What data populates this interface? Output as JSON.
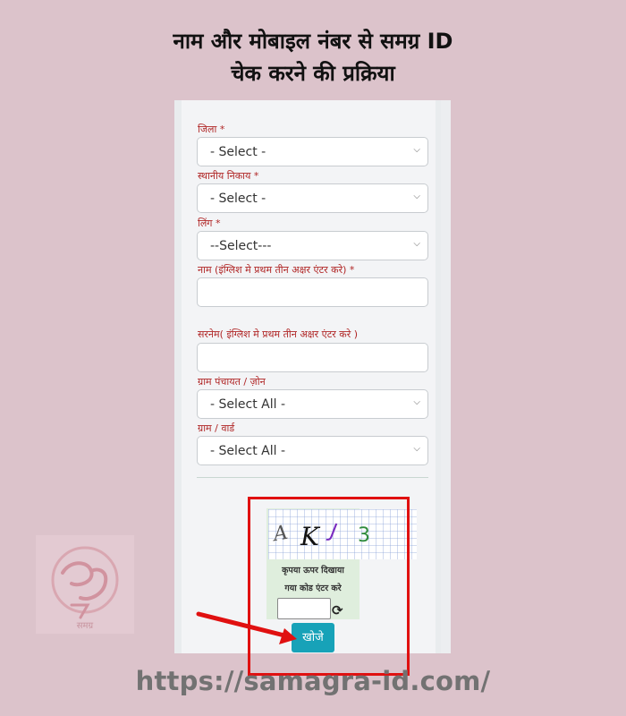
{
  "heading": {
    "line1": "नाम और मोबाइल नंबर से समग्र ID",
    "line2": "चेक करने की प्रक्रिया"
  },
  "form": {
    "district_label": "जिला *",
    "district_value": "- Select -",
    "local_body_label": "स्थानीय निकाय *",
    "local_body_value": "- Select -",
    "gender_label": "लिंग *",
    "gender_value": "--Select---",
    "name_label": "नाम (इंग्लिश मे प्रथम तीन अक्षर एंटर करे) *",
    "name_value": "",
    "surname_label": "सरनेम( इंग्लिश मे प्रथम तीन अक्षर एंटर करे )",
    "surname_value": "",
    "gram_panchayat_label": "ग्राम पंचायत / ज़ोन",
    "gram_panchayat_value": "- Select All -",
    "village_label": "ग्राम / वार्ड",
    "village_value": "- Select All -"
  },
  "captcha": {
    "chars": [
      "A",
      "K",
      "J",
      "3"
    ],
    "message_line1": "कृपया ऊपर दिखाया",
    "message_line2": "गया कोड एंटर करे",
    "input_value": "",
    "refresh_icon": "refresh-icon"
  },
  "search_button": "खोजे",
  "footer_url": "https://samagra-id.com/",
  "logo_text": "समग्र",
  "colors": {
    "background": "#dcc3cb",
    "label_red": "#b02626",
    "button": "#17a2b8",
    "highlight": "#e01010"
  }
}
